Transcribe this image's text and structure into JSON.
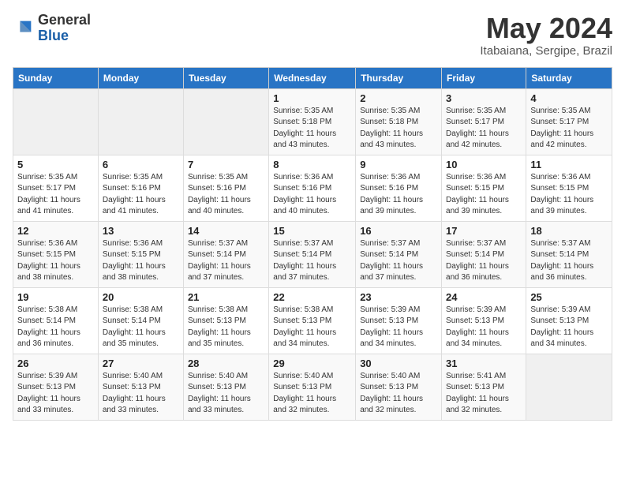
{
  "logo": {
    "general": "General",
    "blue": "Blue"
  },
  "header": {
    "title": "May 2024",
    "subtitle": "Itabaiana, Sergipe, Brazil"
  },
  "days_of_week": [
    "Sunday",
    "Monday",
    "Tuesday",
    "Wednesday",
    "Thursday",
    "Friday",
    "Saturday"
  ],
  "weeks": [
    [
      {
        "num": "",
        "info": ""
      },
      {
        "num": "",
        "info": ""
      },
      {
        "num": "",
        "info": ""
      },
      {
        "num": "1",
        "info": "Sunrise: 5:35 AM\nSunset: 5:18 PM\nDaylight: 11 hours and 43 minutes."
      },
      {
        "num": "2",
        "info": "Sunrise: 5:35 AM\nSunset: 5:18 PM\nDaylight: 11 hours and 43 minutes."
      },
      {
        "num": "3",
        "info": "Sunrise: 5:35 AM\nSunset: 5:17 PM\nDaylight: 11 hours and 42 minutes."
      },
      {
        "num": "4",
        "info": "Sunrise: 5:35 AM\nSunset: 5:17 PM\nDaylight: 11 hours and 42 minutes."
      }
    ],
    [
      {
        "num": "5",
        "info": "Sunrise: 5:35 AM\nSunset: 5:17 PM\nDaylight: 11 hours and 41 minutes."
      },
      {
        "num": "6",
        "info": "Sunrise: 5:35 AM\nSunset: 5:16 PM\nDaylight: 11 hours and 41 minutes."
      },
      {
        "num": "7",
        "info": "Sunrise: 5:35 AM\nSunset: 5:16 PM\nDaylight: 11 hours and 40 minutes."
      },
      {
        "num": "8",
        "info": "Sunrise: 5:36 AM\nSunset: 5:16 PM\nDaylight: 11 hours and 40 minutes."
      },
      {
        "num": "9",
        "info": "Sunrise: 5:36 AM\nSunset: 5:16 PM\nDaylight: 11 hours and 39 minutes."
      },
      {
        "num": "10",
        "info": "Sunrise: 5:36 AM\nSunset: 5:15 PM\nDaylight: 11 hours and 39 minutes."
      },
      {
        "num": "11",
        "info": "Sunrise: 5:36 AM\nSunset: 5:15 PM\nDaylight: 11 hours and 39 minutes."
      }
    ],
    [
      {
        "num": "12",
        "info": "Sunrise: 5:36 AM\nSunset: 5:15 PM\nDaylight: 11 hours and 38 minutes."
      },
      {
        "num": "13",
        "info": "Sunrise: 5:36 AM\nSunset: 5:15 PM\nDaylight: 11 hours and 38 minutes."
      },
      {
        "num": "14",
        "info": "Sunrise: 5:37 AM\nSunset: 5:14 PM\nDaylight: 11 hours and 37 minutes."
      },
      {
        "num": "15",
        "info": "Sunrise: 5:37 AM\nSunset: 5:14 PM\nDaylight: 11 hours and 37 minutes."
      },
      {
        "num": "16",
        "info": "Sunrise: 5:37 AM\nSunset: 5:14 PM\nDaylight: 11 hours and 37 minutes."
      },
      {
        "num": "17",
        "info": "Sunrise: 5:37 AM\nSunset: 5:14 PM\nDaylight: 11 hours and 36 minutes."
      },
      {
        "num": "18",
        "info": "Sunrise: 5:37 AM\nSunset: 5:14 PM\nDaylight: 11 hours and 36 minutes."
      }
    ],
    [
      {
        "num": "19",
        "info": "Sunrise: 5:38 AM\nSunset: 5:14 PM\nDaylight: 11 hours and 36 minutes."
      },
      {
        "num": "20",
        "info": "Sunrise: 5:38 AM\nSunset: 5:14 PM\nDaylight: 11 hours and 35 minutes."
      },
      {
        "num": "21",
        "info": "Sunrise: 5:38 AM\nSunset: 5:13 PM\nDaylight: 11 hours and 35 minutes."
      },
      {
        "num": "22",
        "info": "Sunrise: 5:38 AM\nSunset: 5:13 PM\nDaylight: 11 hours and 34 minutes."
      },
      {
        "num": "23",
        "info": "Sunrise: 5:39 AM\nSunset: 5:13 PM\nDaylight: 11 hours and 34 minutes."
      },
      {
        "num": "24",
        "info": "Sunrise: 5:39 AM\nSunset: 5:13 PM\nDaylight: 11 hours and 34 minutes."
      },
      {
        "num": "25",
        "info": "Sunrise: 5:39 AM\nSunset: 5:13 PM\nDaylight: 11 hours and 34 minutes."
      }
    ],
    [
      {
        "num": "26",
        "info": "Sunrise: 5:39 AM\nSunset: 5:13 PM\nDaylight: 11 hours and 33 minutes."
      },
      {
        "num": "27",
        "info": "Sunrise: 5:40 AM\nSunset: 5:13 PM\nDaylight: 11 hours and 33 minutes."
      },
      {
        "num": "28",
        "info": "Sunrise: 5:40 AM\nSunset: 5:13 PM\nDaylight: 11 hours and 33 minutes."
      },
      {
        "num": "29",
        "info": "Sunrise: 5:40 AM\nSunset: 5:13 PM\nDaylight: 11 hours and 32 minutes."
      },
      {
        "num": "30",
        "info": "Sunrise: 5:40 AM\nSunset: 5:13 PM\nDaylight: 11 hours and 32 minutes."
      },
      {
        "num": "31",
        "info": "Sunrise: 5:41 AM\nSunset: 5:13 PM\nDaylight: 11 hours and 32 minutes."
      },
      {
        "num": "",
        "info": ""
      }
    ]
  ]
}
